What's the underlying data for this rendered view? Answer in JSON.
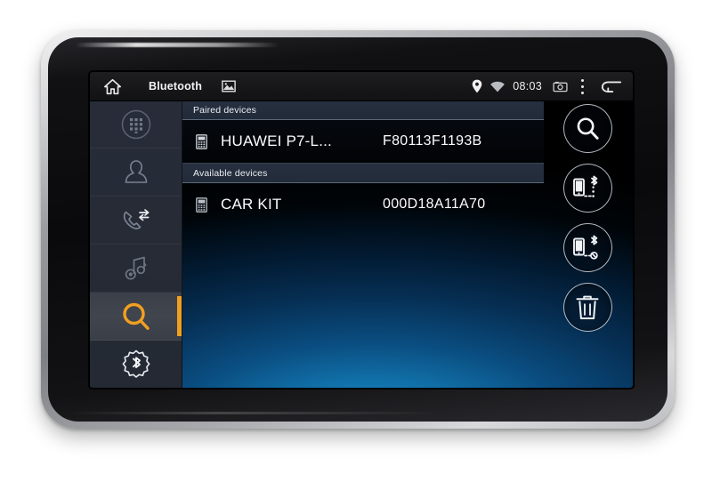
{
  "statusbar": {
    "home_icon": "home-icon",
    "title": "Bluetooth",
    "gallery_icon": "image-icon",
    "location_icon": "location-pin-icon",
    "wifi_icon": "wifi-icon",
    "clock": "08:03",
    "screenshot_icon": "screenshot-camera-icon",
    "overflow_icon": "overflow-menu-icon",
    "back_icon": "back-arrow-icon"
  },
  "sidebar": {
    "items": [
      {
        "name": "dialpad",
        "icon": "dialpad-icon",
        "active": false
      },
      {
        "name": "contacts",
        "icon": "contact-person-icon",
        "active": false
      },
      {
        "name": "call-history",
        "icon": "call-transfer-icon",
        "active": false
      },
      {
        "name": "music",
        "icon": "music-note-icon",
        "active": false
      },
      {
        "name": "search",
        "icon": "search-magnifier-icon",
        "active": true
      },
      {
        "name": "bluetooth-settings",
        "icon": "bluetooth-gear-icon",
        "active": false
      }
    ],
    "accent_color": "#f0a020"
  },
  "list": {
    "groups": [
      {
        "header": "Paired devices",
        "devices": [
          {
            "icon": "phone-device-icon",
            "name": "HUAWEI P7-L...",
            "mac": "F80113F1193B"
          }
        ]
      },
      {
        "header": "Available devices",
        "devices": [
          {
            "icon": "phone-device-icon",
            "name": "CAR KIT",
            "mac": "000D18A11A70"
          }
        ]
      }
    ]
  },
  "actions": [
    {
      "name": "search-devices-button",
      "icon": "search-magnifier-icon"
    },
    {
      "name": "bluetooth-connect-button",
      "icon": "phone-bluetooth-connect-icon"
    },
    {
      "name": "bluetooth-disconnect-button",
      "icon": "phone-bluetooth-disconnect-icon"
    },
    {
      "name": "delete-device-button",
      "icon": "trash-can-icon"
    }
  ]
}
